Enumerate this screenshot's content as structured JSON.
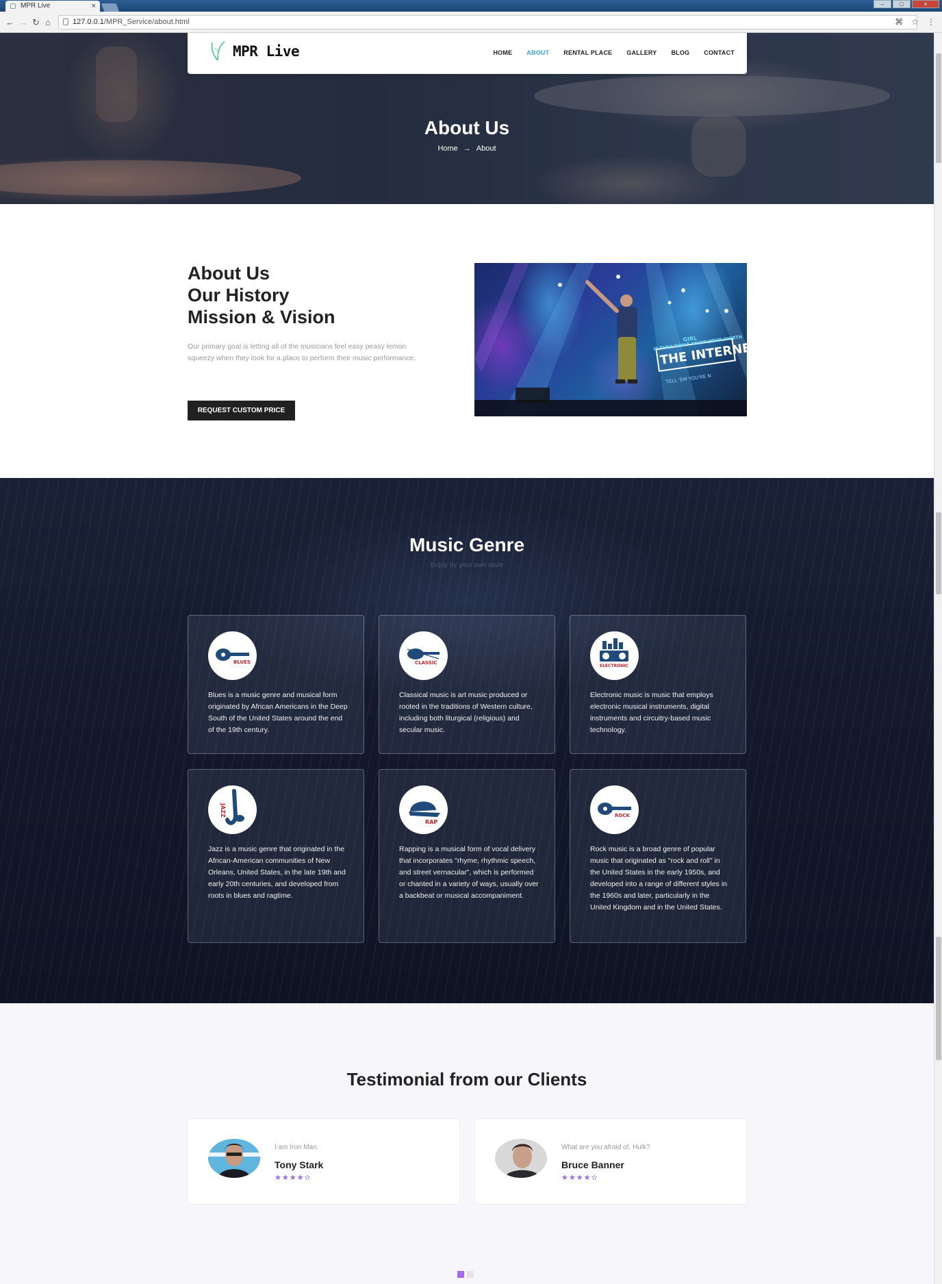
{
  "browser": {
    "tab_title": "MPR Live",
    "tab_close": "×",
    "url_host": "127.0.0.1",
    "url_path": "/MPR_Service/about.html"
  },
  "nav": {
    "brand": "MPR Live",
    "items": [
      {
        "label": "HOME",
        "active": false
      },
      {
        "label": "ABOUT",
        "active": true
      },
      {
        "label": "RENTAL PLACE",
        "active": false
      },
      {
        "label": "GALLERY",
        "active": false
      },
      {
        "label": "BLOG",
        "active": false
      },
      {
        "label": "CONTACT",
        "active": false
      }
    ]
  },
  "hero": {
    "title": "About Us",
    "breadcrumb": {
      "home": "Home",
      "arrow": "→",
      "current": "About"
    }
  },
  "about": {
    "heading_lines": [
      "About Us",
      "Our History",
      "Mission & Vision"
    ],
    "text": "Our primary goal is letting all of the musicians feel easy peasy lemon squeezy when they look for a place to perform their music performance.",
    "button": "REQUEST CUSTOM PRICE",
    "photo_texts": [
      "GIRL",
      "IF THEY DON'T KNOW YOUR WORTH",
      "THE INTERNET",
      "TELL 'EM YOU'RE N"
    ]
  },
  "genre": {
    "title": "Music Genre",
    "subtitle": "Enjoy by your own taste",
    "cards": [
      {
        "icon": "blues-guitar-icon",
        "badge": "BLUES",
        "text": "Blues is a music genre and musical form originated by African Americans in the Deep South of the United States around the end of the 19th century."
      },
      {
        "icon": "classic-violin-icon",
        "badge": "CLASSIC",
        "text": "Classical music is art music produced or rooted in the traditions of Western culture, including both liturgical (religious) and secular music."
      },
      {
        "icon": "electronic-speaker-icon",
        "badge": "ELECTRONIC",
        "text": "Electronic music is music that employs electronic musical instruments, digital instruments and circuitry-based music technology."
      },
      {
        "icon": "jazz-saxophone-icon",
        "badge": "JAZZ",
        "text": "Jazz is a music genre that originated in the African-American communities of New Orleans, United States, in the late 19th and early 20th centuries, and developed from roots in blues and ragtime."
      },
      {
        "icon": "rap-cap-icon",
        "badge": "RAP",
        "text": "Rapping is a musical form of vocal delivery that incorporates \"rhyme, rhythmic speech, and street vernacular\", which is performed or chanted in a variety of ways, usually over a backbeat or musical accompaniment."
      },
      {
        "icon": "rock-guitar-icon",
        "badge": "ROCK",
        "text": "Rock music is a broad genre of popular music that originated as \"rock and roll\" in the United States in the early 1950s, and developed into a range of different styles in the 1960s and later, particularly in the United Kingdom and in the United States."
      }
    ]
  },
  "testimonials": {
    "title": "Testimonial from our Clients",
    "items": [
      {
        "quote": "I am Iron Man.",
        "name": "Tony Stark",
        "stars": "★★★★✫",
        "rating": 4.5
      },
      {
        "quote": "What are you afraid of, Hulk?",
        "name": "Bruce Banner",
        "stars": "★★★★✫",
        "rating": 4.5
      }
    ],
    "pager": {
      "count": 2,
      "active": 0
    }
  },
  "colors": {
    "accent": "#3aa0ea",
    "star": "#9a6ae8",
    "button": "#212121",
    "genre_icon": "#1f4a7a",
    "genre_badge": "#c8242c"
  }
}
